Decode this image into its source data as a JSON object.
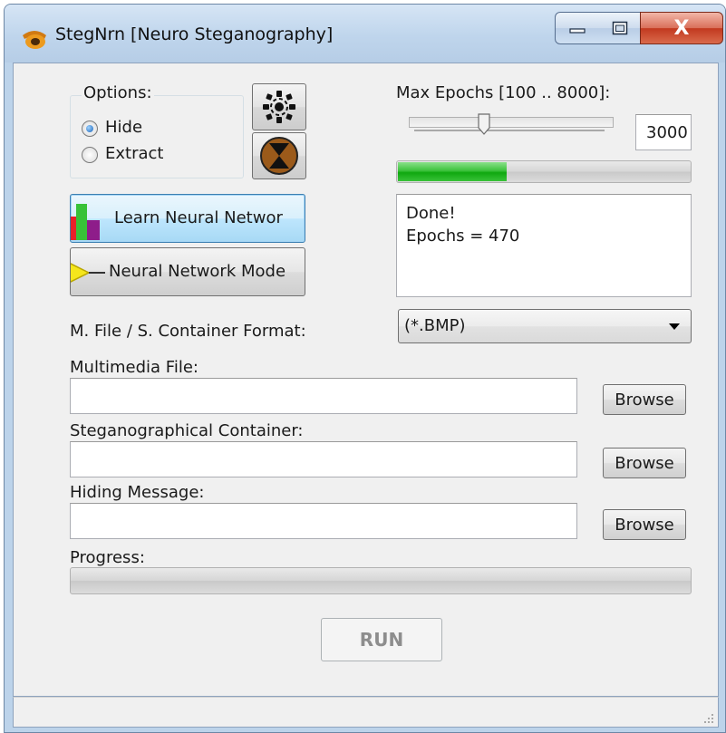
{
  "window": {
    "title": "StegNrn [Neuro Steganography]",
    "close_glyph": "X"
  },
  "options": {
    "title": "Options:",
    "hide_label": "Hide",
    "extract_label": "Extract",
    "selected": "Hide"
  },
  "buttons": {
    "learn_label": "Learn Neural Networ",
    "model_label": "Neural Network Modе",
    "run_label": "RUN"
  },
  "epochs": {
    "label": "Max Epochs [100 .. 8000]:",
    "value": "3000",
    "slider_fraction": 0.36,
    "progress_fraction": 0.37
  },
  "log": {
    "line1": "Done!",
    "line2": "Epochs = 470"
  },
  "format": {
    "label": "M. File / S. Container Format:",
    "selected": "(*.BMP)"
  },
  "fields": {
    "multimedia_label": "Multimedia File:",
    "multimedia_value": "",
    "container_label": "Steganographical Container:",
    "container_value": "",
    "message_label": "Hiding Message:",
    "message_value": "",
    "browse_label": "Browse"
  },
  "progress": {
    "label": "Progress:",
    "fraction": 0
  },
  "colors": {
    "accent_green": "#1fb31f",
    "title_bar": "#bfd5ec",
    "close_red": "#c2391f"
  }
}
